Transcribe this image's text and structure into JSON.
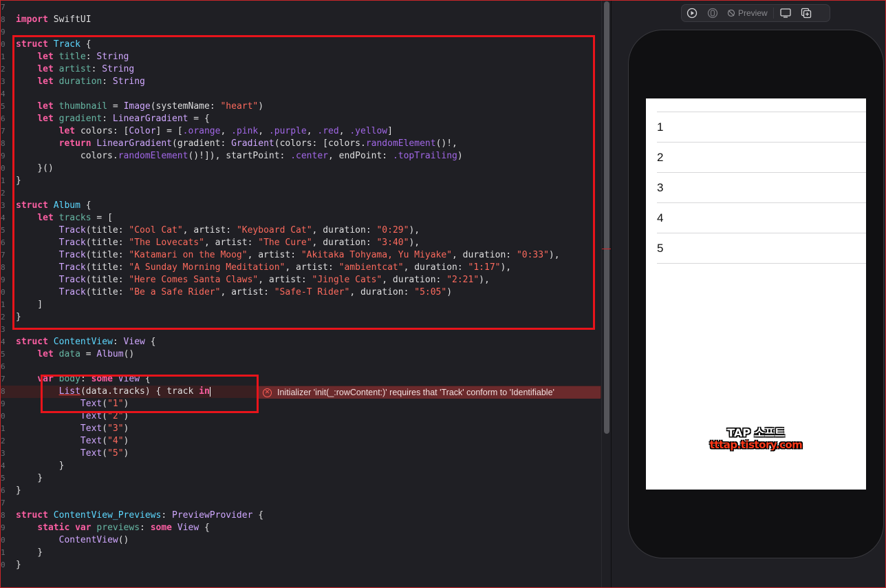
{
  "editor": {
    "line_numbers": [
      "7",
      "8",
      "9",
      "0",
      "1",
      "2",
      "3",
      "4",
      "5",
      "6",
      "7",
      "8",
      "9",
      "0",
      "1",
      "2",
      "3",
      "4",
      "5",
      "6",
      "7",
      "8",
      "9",
      "0",
      "1",
      "2",
      "3",
      "4",
      "5",
      "6",
      "7",
      "8",
      "9",
      "0",
      "1",
      "2",
      "3",
      "4",
      "5",
      "6",
      "7",
      "8",
      "9",
      "0",
      "1"
    ],
    "lines": {
      "l1": "import",
      "l1b": " SwiftUI",
      "track_struct": "struct",
      "track_name": "Track",
      "let": "let",
      "title": "title",
      "artist": "artist",
      "duration": "duration",
      "String": "String",
      "thumbnail": "thumbnail",
      "Image": "Image",
      "systemName": "systemName",
      "heart": "\"heart\"",
      "gradient": "gradient",
      "LinearGradient": "LinearGradient",
      "colors_decl": "colors",
      "Color": "Color",
      "orange": ".orange",
      "pink": ".pink",
      "purple": ".purple",
      "red": ".red",
      "yellow": ".yellow",
      "return": "return",
      "Gradient": "Gradient",
      "randomElement": "randomElement",
      "startPoint": "startPoint",
      "center": ".center",
      "endPoint": "endPoint",
      "topTrailing": ".topTrailing",
      "album_name": "Album",
      "tracks": "tracks",
      "contentview": "ContentView",
      "View": "View",
      "data": "data",
      "var": "var",
      "body": "body",
      "some": "some",
      "List": "List",
      "track_in": "track",
      "in": "in",
      "Text": "Text",
      "previews_struct": "ContentView_Previews",
      "PreviewProvider": "PreviewProvider",
      "static": "static",
      "previews": "previews"
    },
    "tracks": [
      {
        "title": "\"Cool Cat\"",
        "artist": "\"Keyboard Cat\"",
        "duration": "\"0:29\""
      },
      {
        "title": "\"The Lovecats\"",
        "artist": "\"The Cure\"",
        "duration": "\"3:40\""
      },
      {
        "title": "\"Katamari on the Moog\"",
        "artist": "\"Akitaka Tohyama, Yu Miyake\"",
        "duration": "\"0:33\""
      },
      {
        "title": "\"A Sunday Morning Meditation\"",
        "artist": "\"ambientcat\"",
        "duration": "\"1:17\""
      },
      {
        "title": "\"Here Comes Santa Claws\"",
        "artist": "\"Jingle Cats\"",
        "duration": "\"2:21\""
      },
      {
        "title": "\"Be a Safe Rider\"",
        "artist": "\"Safe-T Rider\"",
        "duration": "\"5:05\""
      }
    ],
    "text_items": [
      "\"1\"",
      "\"2\"",
      "\"3\"",
      "\"4\"",
      "\"5\""
    ],
    "error_message": "Initializer 'init(_:rowContent:)' requires that 'Track' conform to 'Identifiable'"
  },
  "preview": {
    "toolbar": {
      "preview_label": "Preview"
    },
    "rows": [
      "1",
      "2",
      "3",
      "4",
      "5"
    ],
    "watermark_line1": "TAP 소프트",
    "watermark_line2": "tttap.tistory.com"
  },
  "colors": {
    "keyword": "#fc5fa3",
    "type": "#5dd8ff",
    "string": "#fc6a5d",
    "error": "#6b2a2c",
    "highlight_box": "#e8141b"
  }
}
